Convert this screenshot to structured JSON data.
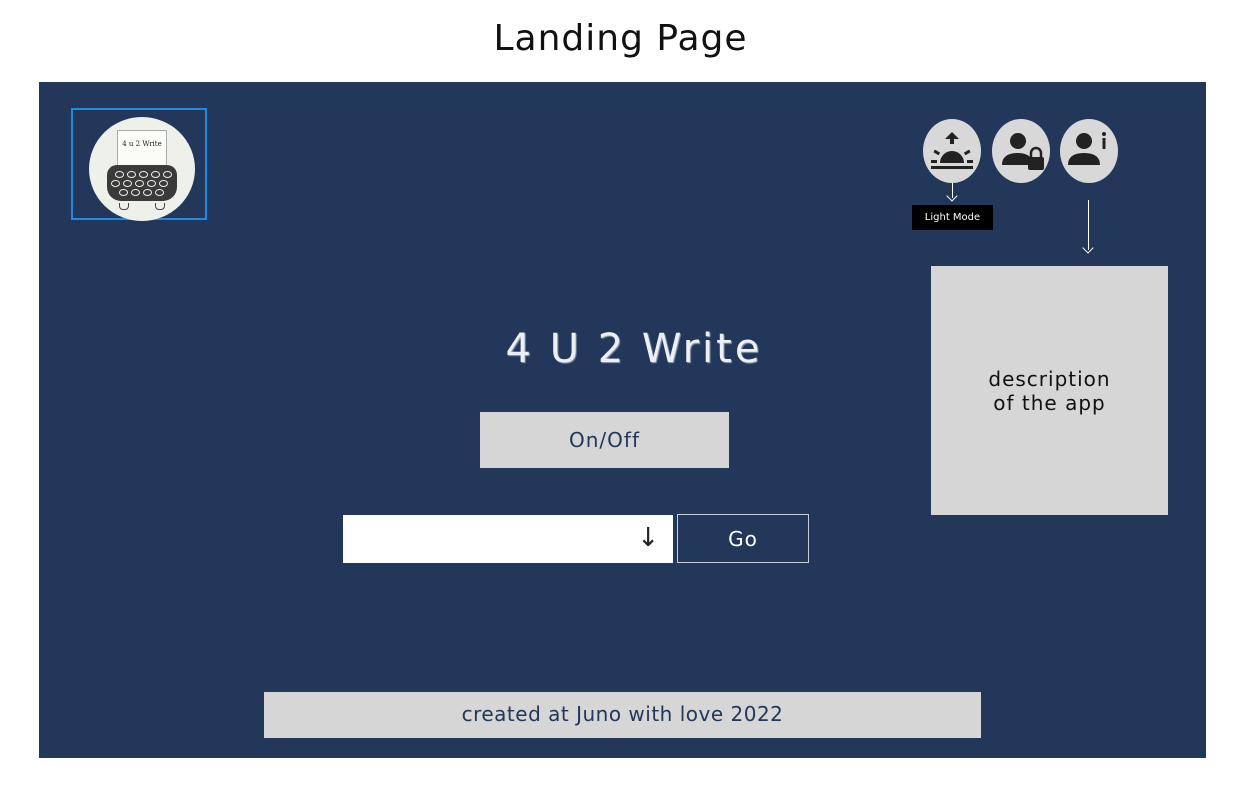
{
  "page_title": "Landing Page",
  "logo": {
    "text": "4 u 2 Write"
  },
  "header_icons": [
    {
      "name": "sun-icon",
      "tooltip": "Light Mode"
    },
    {
      "name": "user-lock-icon"
    },
    {
      "name": "user-info-icon"
    }
  ],
  "app_title": "4 U 2 Write",
  "onoff_button": "On/Off",
  "select": {
    "arrow": "↓"
  },
  "go_button": "Go",
  "description": "description\nof the app",
  "footer": "created at Juno with love 2022",
  "colors": {
    "background": "#23375a",
    "panel": "#d6d6d6",
    "logo_border": "#1e8be0"
  }
}
